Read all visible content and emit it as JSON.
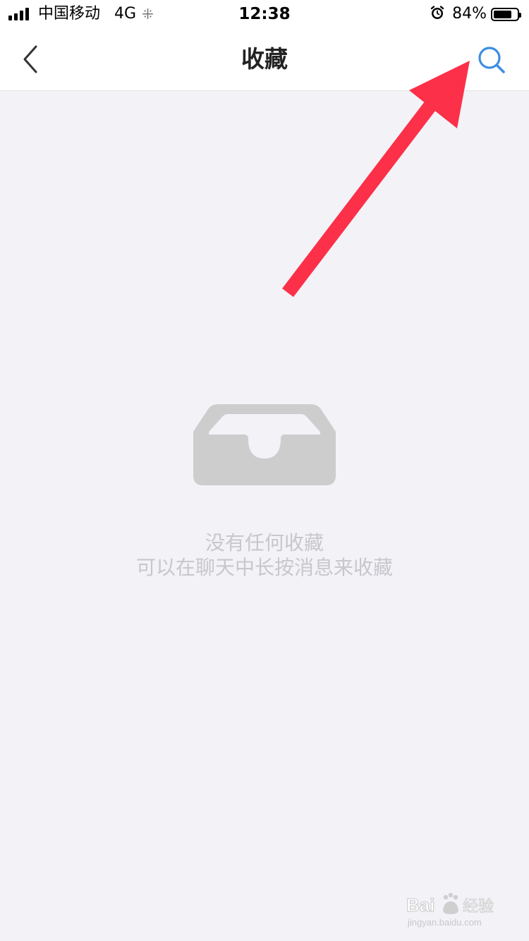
{
  "status_bar": {
    "carrier": "中国移动",
    "network": "4G",
    "time": "12:38",
    "battery_percent": "84%",
    "battery_level": 0.84,
    "icons": [
      "signal-icon",
      "loading-icon",
      "alarm-icon",
      "battery-icon"
    ]
  },
  "nav": {
    "title": "收藏",
    "back_icon": "chevron-left-icon",
    "search_icon": "search-icon",
    "accent_color": "#3d8ee0"
  },
  "empty_state": {
    "icon": "inbox-tray-icon",
    "line1": "没有任何收藏",
    "line2": "可以在聊天中长按消息来收藏",
    "text_color": "#c7c7cc",
    "icon_color": "#cdcdcd"
  },
  "annotation": {
    "type": "arrow",
    "color": "#fc3049",
    "points_to": "search-icon"
  },
  "watermark": {
    "logo": "Bai du 经验",
    "url": "jingyan.baidu.com"
  }
}
